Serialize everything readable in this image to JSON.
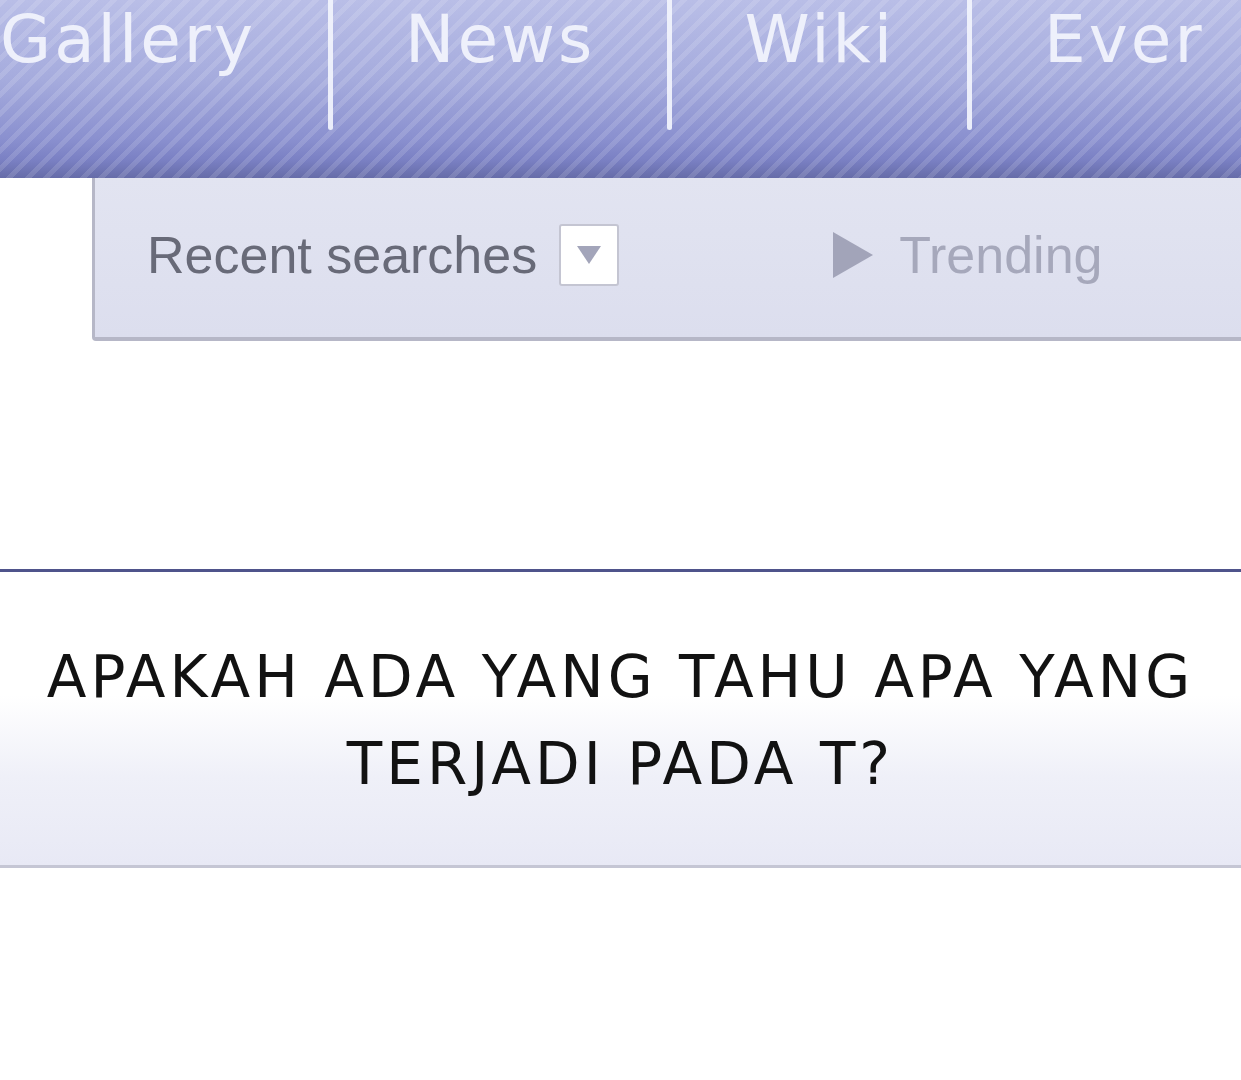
{
  "nav": {
    "tabs": [
      {
        "label": "Gallery"
      },
      {
        "label": "News"
      },
      {
        "label": "Wiki"
      },
      {
        "label": "Ever"
      }
    ]
  },
  "search_panel": {
    "options": [
      {
        "kind": "dropdown",
        "label": "Recent searches",
        "selected": true
      },
      {
        "kind": "toggle",
        "label": "Trending",
        "selected": false
      }
    ]
  },
  "caption": {
    "text": "APAKAH ADA YANG TAHU APA YANG TERJADI PADA T?"
  }
}
